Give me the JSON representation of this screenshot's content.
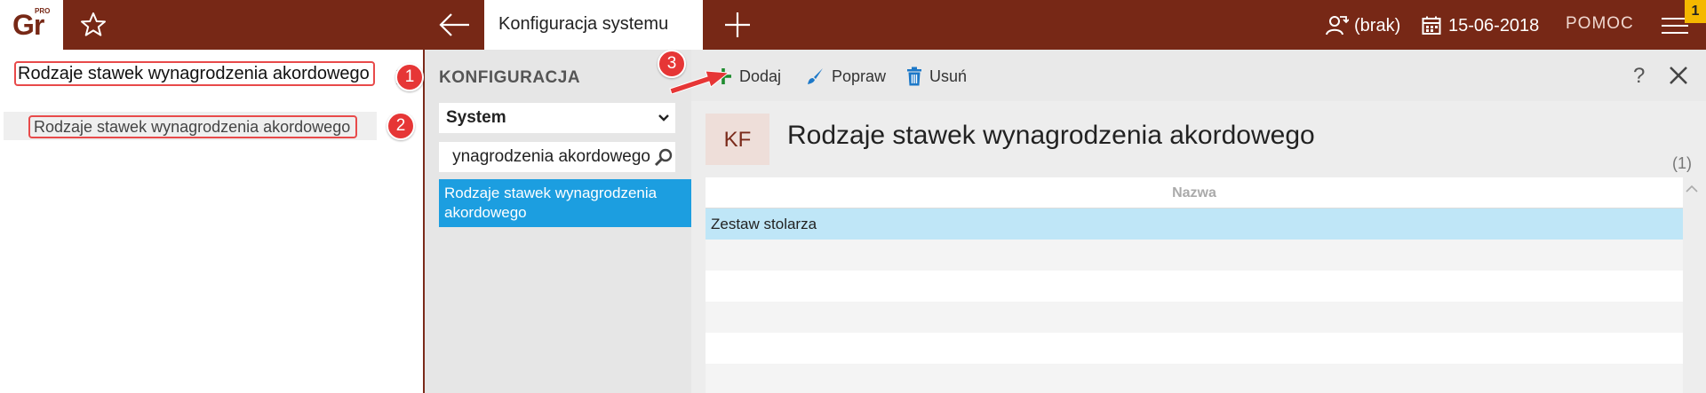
{
  "header": {
    "logo_text": "Gr",
    "logo_badge": "PRO",
    "active_tab_label": "Konfiguracja systemu",
    "user_label": "(brak)",
    "date_label": "15-06-2018",
    "help_label": "POMOC",
    "notification_count": "1"
  },
  "left_panel": {
    "search_value": "Rodzaje stawek wynagrodzenia akordowego",
    "result_label": "Rodzaje stawek wynagrodzenia akordowego"
  },
  "config_nav": {
    "title": "KONFIGURACJA",
    "module_select_value": "System",
    "search_value": "ynagrodzenia akordowego",
    "active_item_label": "Rodzaje stawek wynagrodzenia akordowego"
  },
  "toolbar": {
    "add_label": "Dodaj",
    "edit_label": "Popraw",
    "delete_label": "Usuń",
    "help_label": "?"
  },
  "main": {
    "badge_text": "KF",
    "title": "Rodzaje stawek wynagrodzenia akordowego",
    "record_count": "(1)",
    "grid": {
      "column_header": "Nazwa",
      "rows": [
        "Zestaw stolarza"
      ]
    }
  },
  "callouts": [
    "1",
    "2",
    "3"
  ],
  "colors": {
    "header_bg": "#772816",
    "accent_selected": "#1c9ee0",
    "row_selected": "#bfe6f7",
    "callout_red": "#e63636",
    "add_green": "#1e8c2e",
    "notification_yellow": "#f5b800"
  }
}
